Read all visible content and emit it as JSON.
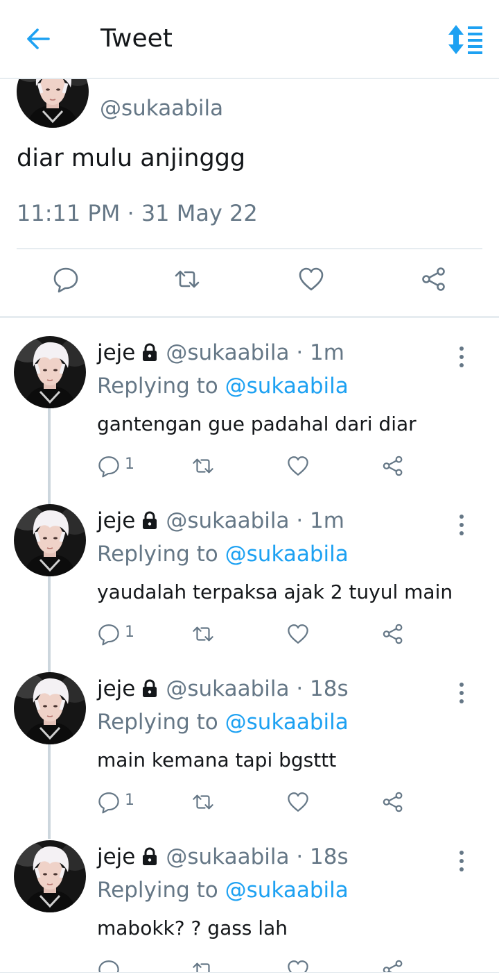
{
  "header": {
    "title": "Tweet",
    "back_icon": "arrow-left-icon",
    "sort_icon": "sort-toggle-icon",
    "accent": "#1da1f2"
  },
  "main_tweet": {
    "handle": "@sukaabila",
    "text": "diar mulu anjinggg",
    "timestamp": "11:11 PM · 31 May 22",
    "actions": [
      "reply-icon",
      "retweet-icon",
      "like-icon",
      "share-icon"
    ]
  },
  "replies": [
    {
      "name": "jeje",
      "handle": "@sukaabila",
      "time": "· 1m",
      "replying_label": "Replying to",
      "replying_to": "@sukaabila",
      "text": "gantengan gue padahal dari diar",
      "reply_count": "1"
    },
    {
      "name": "jeje",
      "handle": "@sukaabila",
      "time": "· 1m",
      "replying_label": "Replying to",
      "replying_to": "@sukaabila",
      "text": "yaudalah terpaksa ajak 2 tuyul main",
      "reply_count": "1"
    },
    {
      "name": "jeje",
      "handle": "@sukaabila",
      "time": "· 18s",
      "replying_label": "Replying to",
      "replying_to": "@sukaabila",
      "text": "main kemana tapi bgsttt",
      "reply_count": "1"
    },
    {
      "name": "jeje",
      "handle": "@sukaabila",
      "time": "· 18s",
      "replying_label": "Replying to",
      "replying_to": "@sukaabila",
      "text": "mabokk? ?  gass lah",
      "reply_count": ""
    }
  ]
}
